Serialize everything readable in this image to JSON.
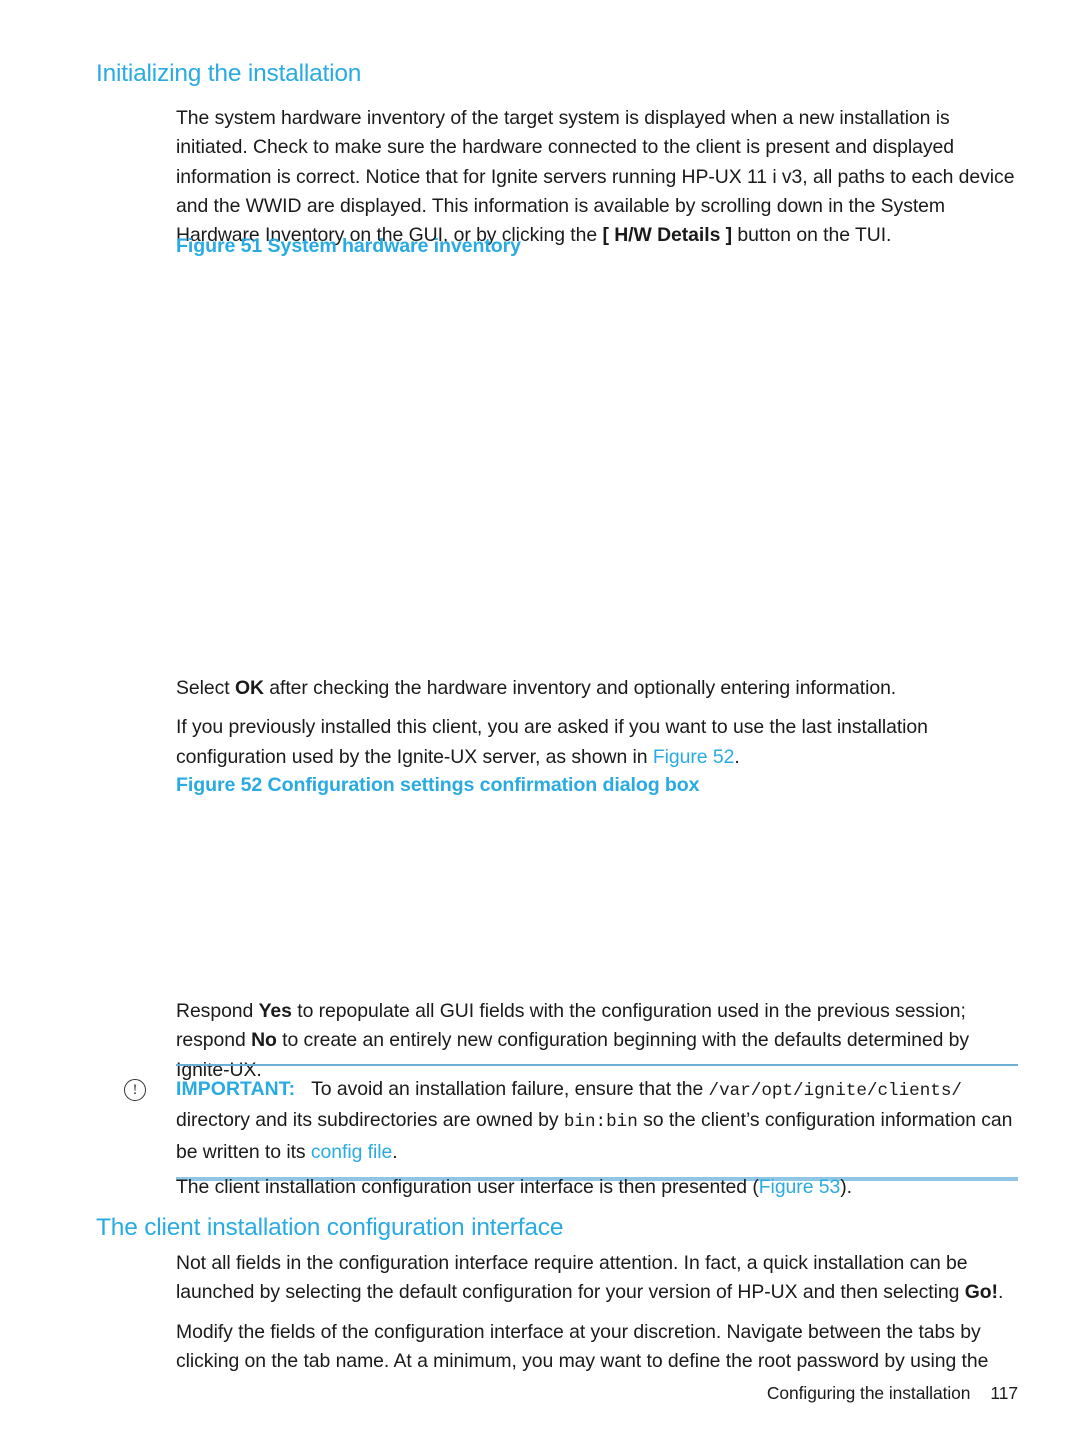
{
  "page": {
    "number": "117",
    "footer_title": "Configuring the installation",
    "accent_color": "#29ABE2",
    "text_color": "#1a1a1a"
  },
  "section1": {
    "heading": "Initializing the installation",
    "paragraph1_a": "The system hardware inventory of the target system is displayed when a new installation is initiated. Check to make sure the hardware connected to the client is present and displayed information is correct. Notice that for Ignite servers running HP-UX 11 i v3, all paths to each device and the WWID are displayed. This information is available by scrolling down in the System Hardware Inventory on the GUI, or by clicking the ",
    "paragraph1_bold": "[ H/W Details ]",
    "paragraph1_b": " button on the TUI."
  },
  "figure51": {
    "label": "Figure 51",
    "caption": "Figure 51 System hardware inventory"
  },
  "section2": {
    "paragraph_select_a": "Select ",
    "paragraph_select_bold": "OK",
    "paragraph_select_b": " after checking the hardware inventory and optionally entering information.",
    "paragraph_prev_a": "If you previously installed this client, you are asked if you want to use the last installation configuration used by the Ignite-UX server, as shown in ",
    "paragraph_prev_link": "Figure 52",
    "paragraph_prev_b": "."
  },
  "figure52": {
    "label": "Figure 52",
    "caption": "Figure 52 Configuration settings confirmation dialog box"
  },
  "section3": {
    "respond_a": "Respond ",
    "respond_yes": "Yes",
    "respond_b": " to repopulate all GUI fields with the configuration used in the previous session; respond ",
    "respond_no": "No",
    "respond_c": " to create an entirely new configuration beginning with the defaults determined by Ignite-UX."
  },
  "important": {
    "icon": "important-exclamation-icon",
    "glyph": "!",
    "label": "IMPORTANT:",
    "text_a": "To avoid an installation failure, ensure that the ",
    "path": "/var/opt/ignite/clients/",
    "text_b": " directory and its subdirectories are owned by ",
    "owner": "bin:bin",
    "text_c": " so the client’s configuration information can be written to its ",
    "link": "config file",
    "text_d": "."
  },
  "section4": {
    "presented_a": "The client installation configuration user interface is then presented (",
    "presented_link": "Figure 53",
    "presented_b": ")."
  },
  "section5": {
    "heading": "The client installation configuration interface",
    "paragraph1_a": "Not all fields in the configuration interface require attention. In fact, a quick installation can be launched by selecting the default configuration for your version of HP-UX and then selecting ",
    "paragraph1_bold": "Go!",
    "paragraph1_b": ".",
    "paragraph2": "Modify the fields of the configuration interface at your discretion. Navigate between the tabs by clicking on the tab name. At a minimum, you may want to define the root password by using the"
  }
}
